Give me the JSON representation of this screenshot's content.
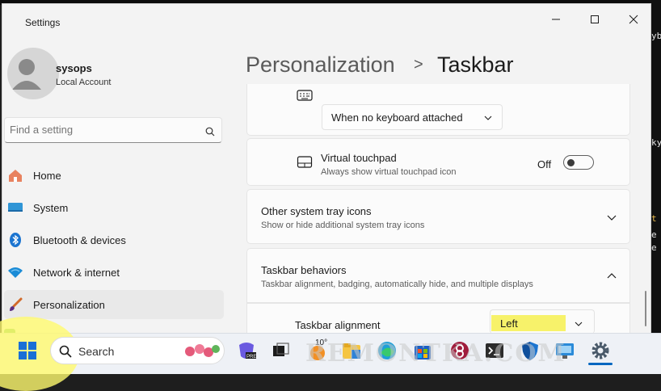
{
  "window": {
    "title": "Settings"
  },
  "user": {
    "name": "sysops",
    "account_type": "Local Account"
  },
  "search": {
    "placeholder": "Find a setting"
  },
  "sidebar": {
    "items": [
      {
        "label": "Home",
        "icon": "home-icon"
      },
      {
        "label": "System",
        "icon": "system-icon"
      },
      {
        "label": "Bluetooth & devices",
        "icon": "bluetooth-icon"
      },
      {
        "label": "Network & internet",
        "icon": "wifi-icon"
      },
      {
        "label": "Personalization",
        "icon": "brush-icon",
        "selected": true
      }
    ]
  },
  "breadcrumb": {
    "parent": "Personalization",
    "separator": ">",
    "current": "Taskbar"
  },
  "content": {
    "touch_keyboard": {
      "dropdown_value": "When no keyboard attached"
    },
    "virtual_touchpad": {
      "title": "Virtual touchpad",
      "subtitle": "Always show virtual touchpad icon",
      "state_label": "Off",
      "on": false
    },
    "other_tray": {
      "title": "Other system tray icons",
      "subtitle": "Show or hide additional system tray icons"
    },
    "behaviors": {
      "title": "Taskbar behaviors",
      "subtitle": "Taskbar alignment, badging, automatically hide, and multiple displays"
    },
    "alignment": {
      "title": "Taskbar alignment",
      "value": "Left"
    }
  },
  "taskbar": {
    "search_label": "Search",
    "weather_temp": "10°",
    "watermark": "REMONTKA.COM"
  },
  "terminal_fragments": [
    "yb",
    "ky",
    "t",
    "e",
    "e"
  ],
  "colors": {
    "accent": "#0067c0",
    "highlight": "#f7f26a",
    "start_glow": "#fffa6e"
  }
}
